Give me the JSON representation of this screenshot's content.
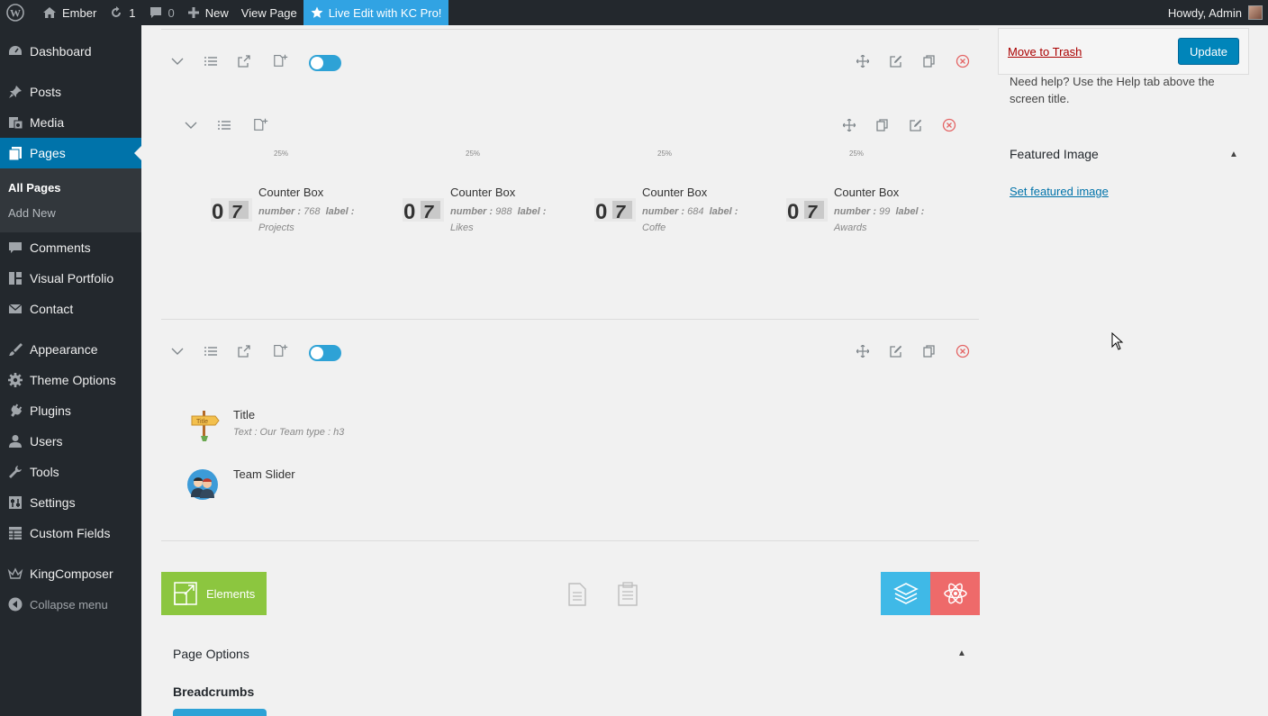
{
  "adminbar": {
    "site_name": "Ember",
    "updates_count": "1",
    "comments_count": "0",
    "new_label": "New",
    "view_page_label": "View Page",
    "live_edit_label": "Live Edit with KC Pro!",
    "howdy_label": "Howdy, Admin"
  },
  "sidebar": {
    "items": [
      {
        "label": "Dashboard",
        "icon": "dashboard-icon"
      },
      {
        "label": "Posts",
        "icon": "pin-icon"
      },
      {
        "label": "Media",
        "icon": "media-icon"
      },
      {
        "label": "Pages",
        "icon": "pages-icon"
      },
      {
        "label": "Comments",
        "icon": "comment-icon"
      },
      {
        "label": "Visual Portfolio",
        "icon": "grid-icon"
      },
      {
        "label": "Contact",
        "icon": "mail-icon"
      },
      {
        "label": "Appearance",
        "icon": "brush-icon"
      },
      {
        "label": "Theme Options",
        "icon": "gear-icon"
      },
      {
        "label": "Plugins",
        "icon": "plug-icon"
      },
      {
        "label": "Users",
        "icon": "user-icon"
      },
      {
        "label": "Tools",
        "icon": "wrench-icon"
      },
      {
        "label": "Settings",
        "icon": "settings-icon"
      },
      {
        "label": "Custom Fields",
        "icon": "table-icon"
      },
      {
        "label": "KingComposer",
        "icon": "crown-icon"
      },
      {
        "label": "Collapse menu",
        "icon": "collapse-icon"
      }
    ],
    "submenu": {
      "all_pages": "All Pages",
      "add_new": "Add New"
    }
  },
  "builder": {
    "column_widths": [
      "25%",
      "25%",
      "25%",
      "25%"
    ],
    "counters": [
      {
        "title": "Counter Box",
        "number_key": "number :",
        "number": "768",
        "label_key": "label :",
        "label": "Projects"
      },
      {
        "title": "Counter Box",
        "number_key": "number :",
        "number": "988",
        "label_key": "label :",
        "label": "Likes"
      },
      {
        "title": "Counter Box",
        "number_key": "number :",
        "number": "684",
        "label_key": "label :",
        "label": "Coffe"
      },
      {
        "title": "Counter Box",
        "number_key": "number :",
        "number": "99",
        "label_key": "label :",
        "label": "Awards"
      }
    ],
    "title_element": {
      "name": "Title",
      "desc": "Text : Our Team  type : h3"
    },
    "team_slider": {
      "name": "Team Slider"
    },
    "elements_label": "Elements",
    "page_options_label": "Page Options",
    "breadcrumbs_label": "Breadcrumbs"
  },
  "publish": {
    "trash_label": "Move to Trash",
    "update_label": "Update",
    "help_text": "Need help? Use the Help tab above the screen title."
  },
  "featured_image": {
    "title": "Featured Image",
    "link_label": "Set featured image"
  },
  "colors": {
    "admin_bar": "#23282d",
    "active_menu": "#0073aa",
    "elements_button": "#8cc63f",
    "layers_button": "#3fb9e7",
    "react_button": "#ee6a6a",
    "kc_pro": "#31a3e3"
  }
}
